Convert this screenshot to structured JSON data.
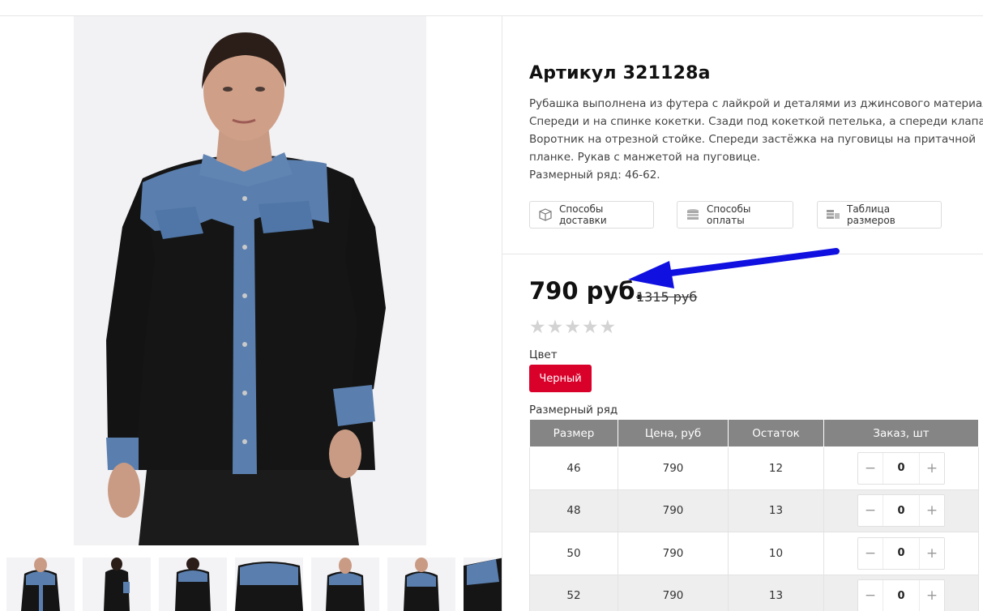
{
  "product": {
    "title": "Артикул 321128а",
    "description": [
      "Рубашка выполнена из футера с лайкрой и деталями из джинсового материала.",
      "Спереди и на спинке кокетки. Сзади под кокеткой петелька, а спереди клапаны.",
      "Воротник на отрезной стойке. Спереди застёжка на пуговицы на притачной",
      "планке. Рукав с манжетой на пуговице.",
      "Размерный ряд: 46-62."
    ],
    "info_buttons": [
      {
        "label": "Способы доставки",
        "icon": "box-icon"
      },
      {
        "label": "Способы оплаты",
        "icon": "coins-icon"
      },
      {
        "label": "Таблица размеров",
        "icon": "size-table-icon"
      }
    ],
    "price": "790 руб.",
    "old_price": "1315 руб",
    "rating": 0,
    "rating_max": 5,
    "color_label": "Цвет",
    "selected_color": "Черный",
    "size_range_label": "Размерный ряд"
  },
  "size_table": {
    "headers": [
      "Размер",
      "Цена, руб",
      "Остаток",
      "Заказ, шт"
    ],
    "rows": [
      {
        "size": "46",
        "price": "790",
        "stock": "12",
        "qty": "0"
      },
      {
        "size": "48",
        "price": "790",
        "stock": "13",
        "qty": "0"
      },
      {
        "size": "50",
        "price": "790",
        "stock": "10",
        "qty": "0"
      },
      {
        "size": "52",
        "price": "790",
        "stock": "13",
        "qty": "0"
      }
    ],
    "minus": "−",
    "plus": "+"
  },
  "colors": {
    "accent": "#d9002a",
    "table_header": "#868585",
    "arrow": "#1010e0",
    "shirt": "#141414",
    "denim": "#5a7fae"
  }
}
